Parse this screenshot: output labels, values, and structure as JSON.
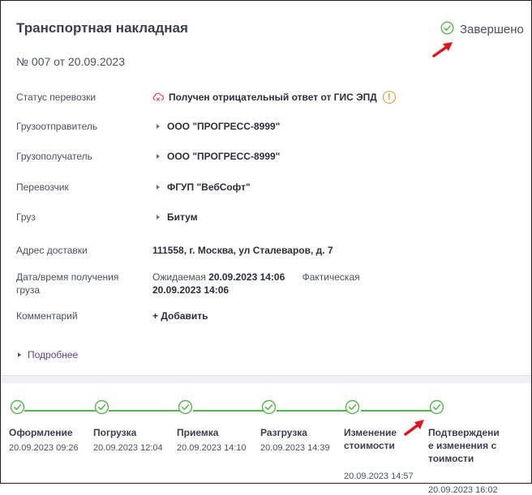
{
  "header": {
    "title": "Транспортная накладная",
    "status": "Завершено",
    "doc_number": "№ 007 от 20.09.2023"
  },
  "fields": {
    "transport_status": {
      "label": "Статус перевозки",
      "value": "Получен отрицательный ответ от ГИС ЭПД",
      "warn": "!"
    },
    "shipper": {
      "label": "Грузоотправитель",
      "value": "ООО \"ПРОГРЕСС-8999\""
    },
    "consignee": {
      "label": "Грузополучатель",
      "value": "ООО \"ПРОГРЕСС-8999\""
    },
    "carrier": {
      "label": "Перевозчик",
      "value": "ФГУП \"ВебСофт\""
    },
    "cargo": {
      "label": "Груз",
      "value": "Битум"
    },
    "address": {
      "label": "Адрес доставки",
      "value": "111558, г. Москва, ул Сталеваров, д. 7"
    },
    "datetime": {
      "label": "Дата/время получения груза",
      "expected_label": "Ожидаемая",
      "expected_value": "20.09.2023 14:06",
      "actual_label": "Фактическая",
      "actual_value": "20.09.2023 14:06"
    },
    "comment": {
      "label": "Комментарий",
      "add": "+ Добавить"
    }
  },
  "more": "Подробнее",
  "timeline": [
    {
      "name": "Оформление",
      "date": "20.09.2023 09:26"
    },
    {
      "name": "Погрузка",
      "date": "20.09.2023 12:04"
    },
    {
      "name": "Приемка",
      "date": "20.09.2023 14:10"
    },
    {
      "name": "Разгрузка",
      "date": "20.09.2023 14:39"
    },
    {
      "name": "Изменение стоимости",
      "date": "20.09.2023 14:57"
    },
    {
      "name": "Подтверждение изменения стоимости",
      "date": "20.09.2023 16:02"
    }
  ],
  "colors": {
    "success": "#52b848",
    "warning": "#f0921d",
    "link": "#5b3fa8",
    "arrow": "#e8101a",
    "error": "#e0434b"
  },
  "icons": {
    "status": "check-circle-icon",
    "transport": "cloud-error-icon",
    "warning": "warning-circle-icon",
    "pointer": "red-arrow-pointer-icon"
  }
}
